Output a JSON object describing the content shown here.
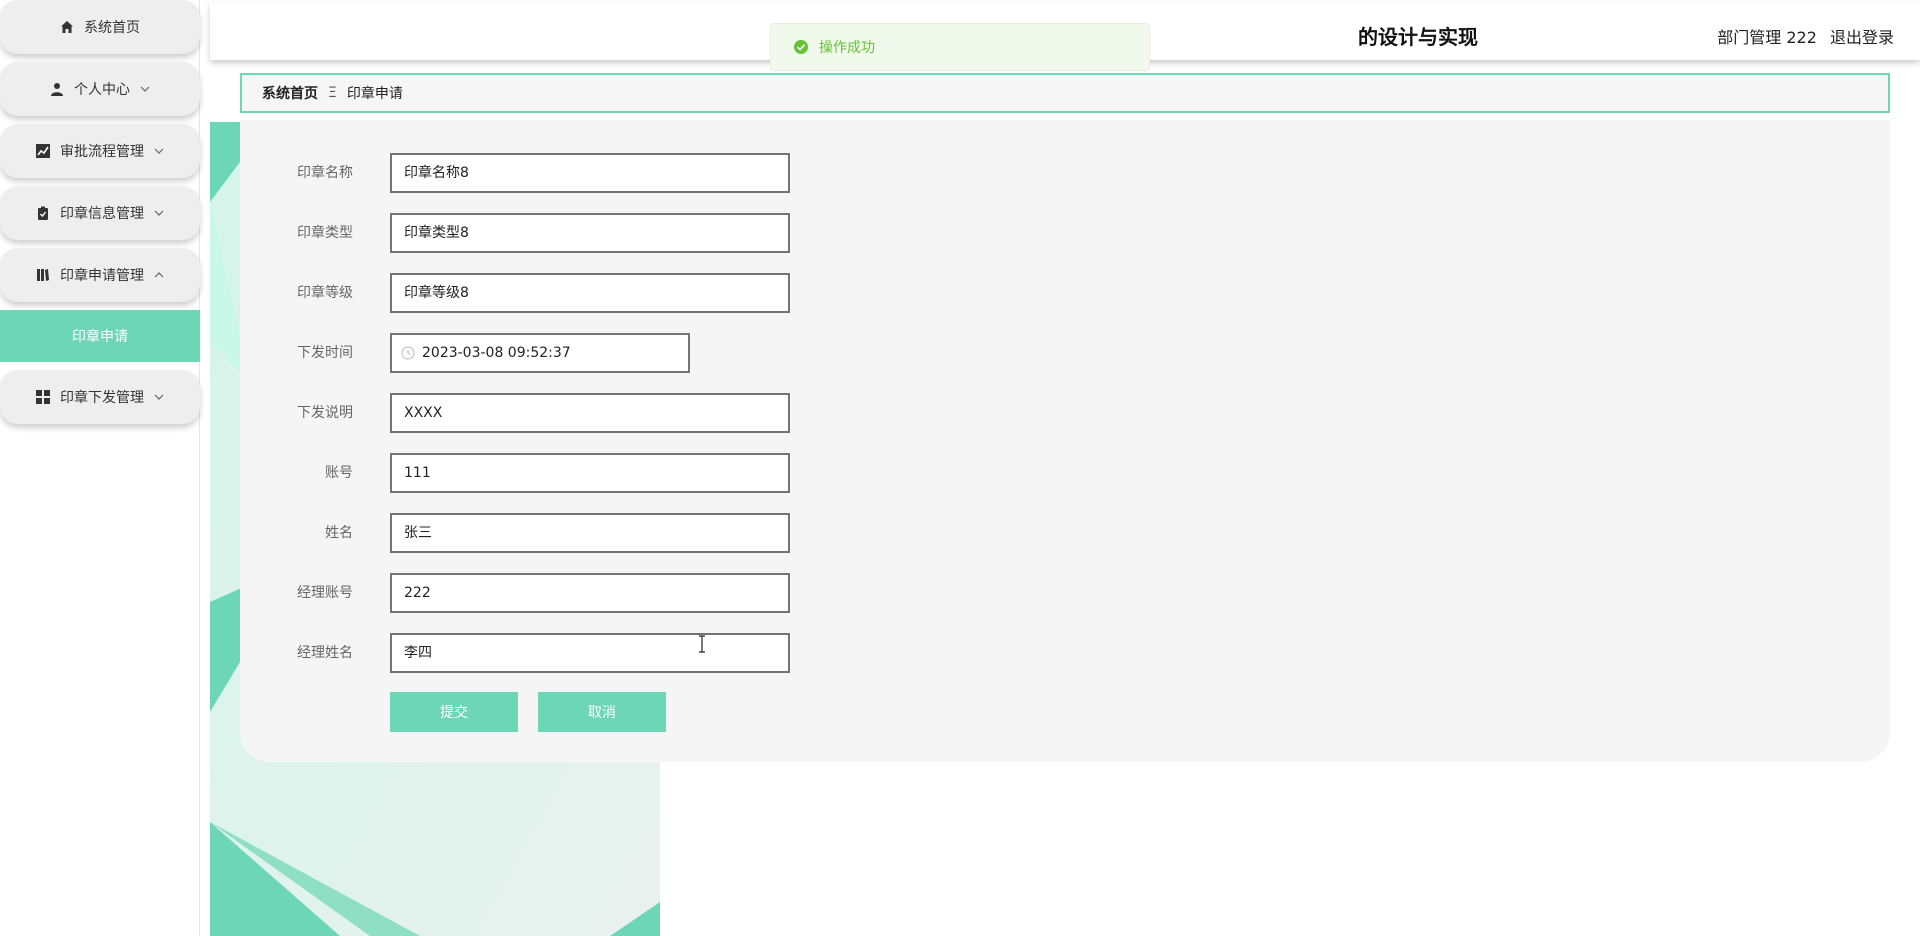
{
  "sidebar": {
    "items": [
      {
        "label": "系统首页",
        "icon": "home-icon",
        "has_chevron": false
      },
      {
        "label": "个人中心",
        "icon": "user-icon",
        "has_chevron": true,
        "expanded": false
      },
      {
        "label": "审批流程管理",
        "icon": "chart-icon",
        "has_chevron": true,
        "expanded": false
      },
      {
        "label": "印章信息管理",
        "icon": "clipboard-icon",
        "has_chevron": true,
        "expanded": false
      },
      {
        "label": "印章申请管理",
        "icon": "book-icon",
        "has_chevron": true,
        "expanded": true
      },
      {
        "label": "印章下发管理",
        "icon": "grid-icon",
        "has_chevron": true,
        "expanded": false
      }
    ],
    "sub_item": {
      "label": "印章申请",
      "active": true
    }
  },
  "header": {
    "title": "的设计与实现",
    "user_label": "部门管理 222",
    "logout_label": "退出登录"
  },
  "toast": {
    "message": "操作成功",
    "type": "success"
  },
  "breadcrumb": {
    "home": "系统首页",
    "separator": "Ξ",
    "current": "印章申请"
  },
  "form": {
    "fields": [
      {
        "label": "印章名称",
        "value": "印章名称8"
      },
      {
        "label": "印章类型",
        "value": "印章类型8"
      },
      {
        "label": "印章等级",
        "value": "印章等级8"
      },
      {
        "label": "下发时间",
        "value": "2023-03-08 09:52:37"
      },
      {
        "label": "下发说明",
        "value": "XXXX"
      },
      {
        "label": "账号",
        "value": "111"
      },
      {
        "label": "姓名",
        "value": "张三"
      },
      {
        "label": "经理账号",
        "value": "222"
      },
      {
        "label": "经理姓名",
        "value": "李四"
      }
    ],
    "submit_label": "提交",
    "cancel_label": "取消"
  },
  "colors": {
    "accent": "#6cd6b5",
    "success": "#67c23a",
    "toast_bg": "#f0f9eb"
  }
}
